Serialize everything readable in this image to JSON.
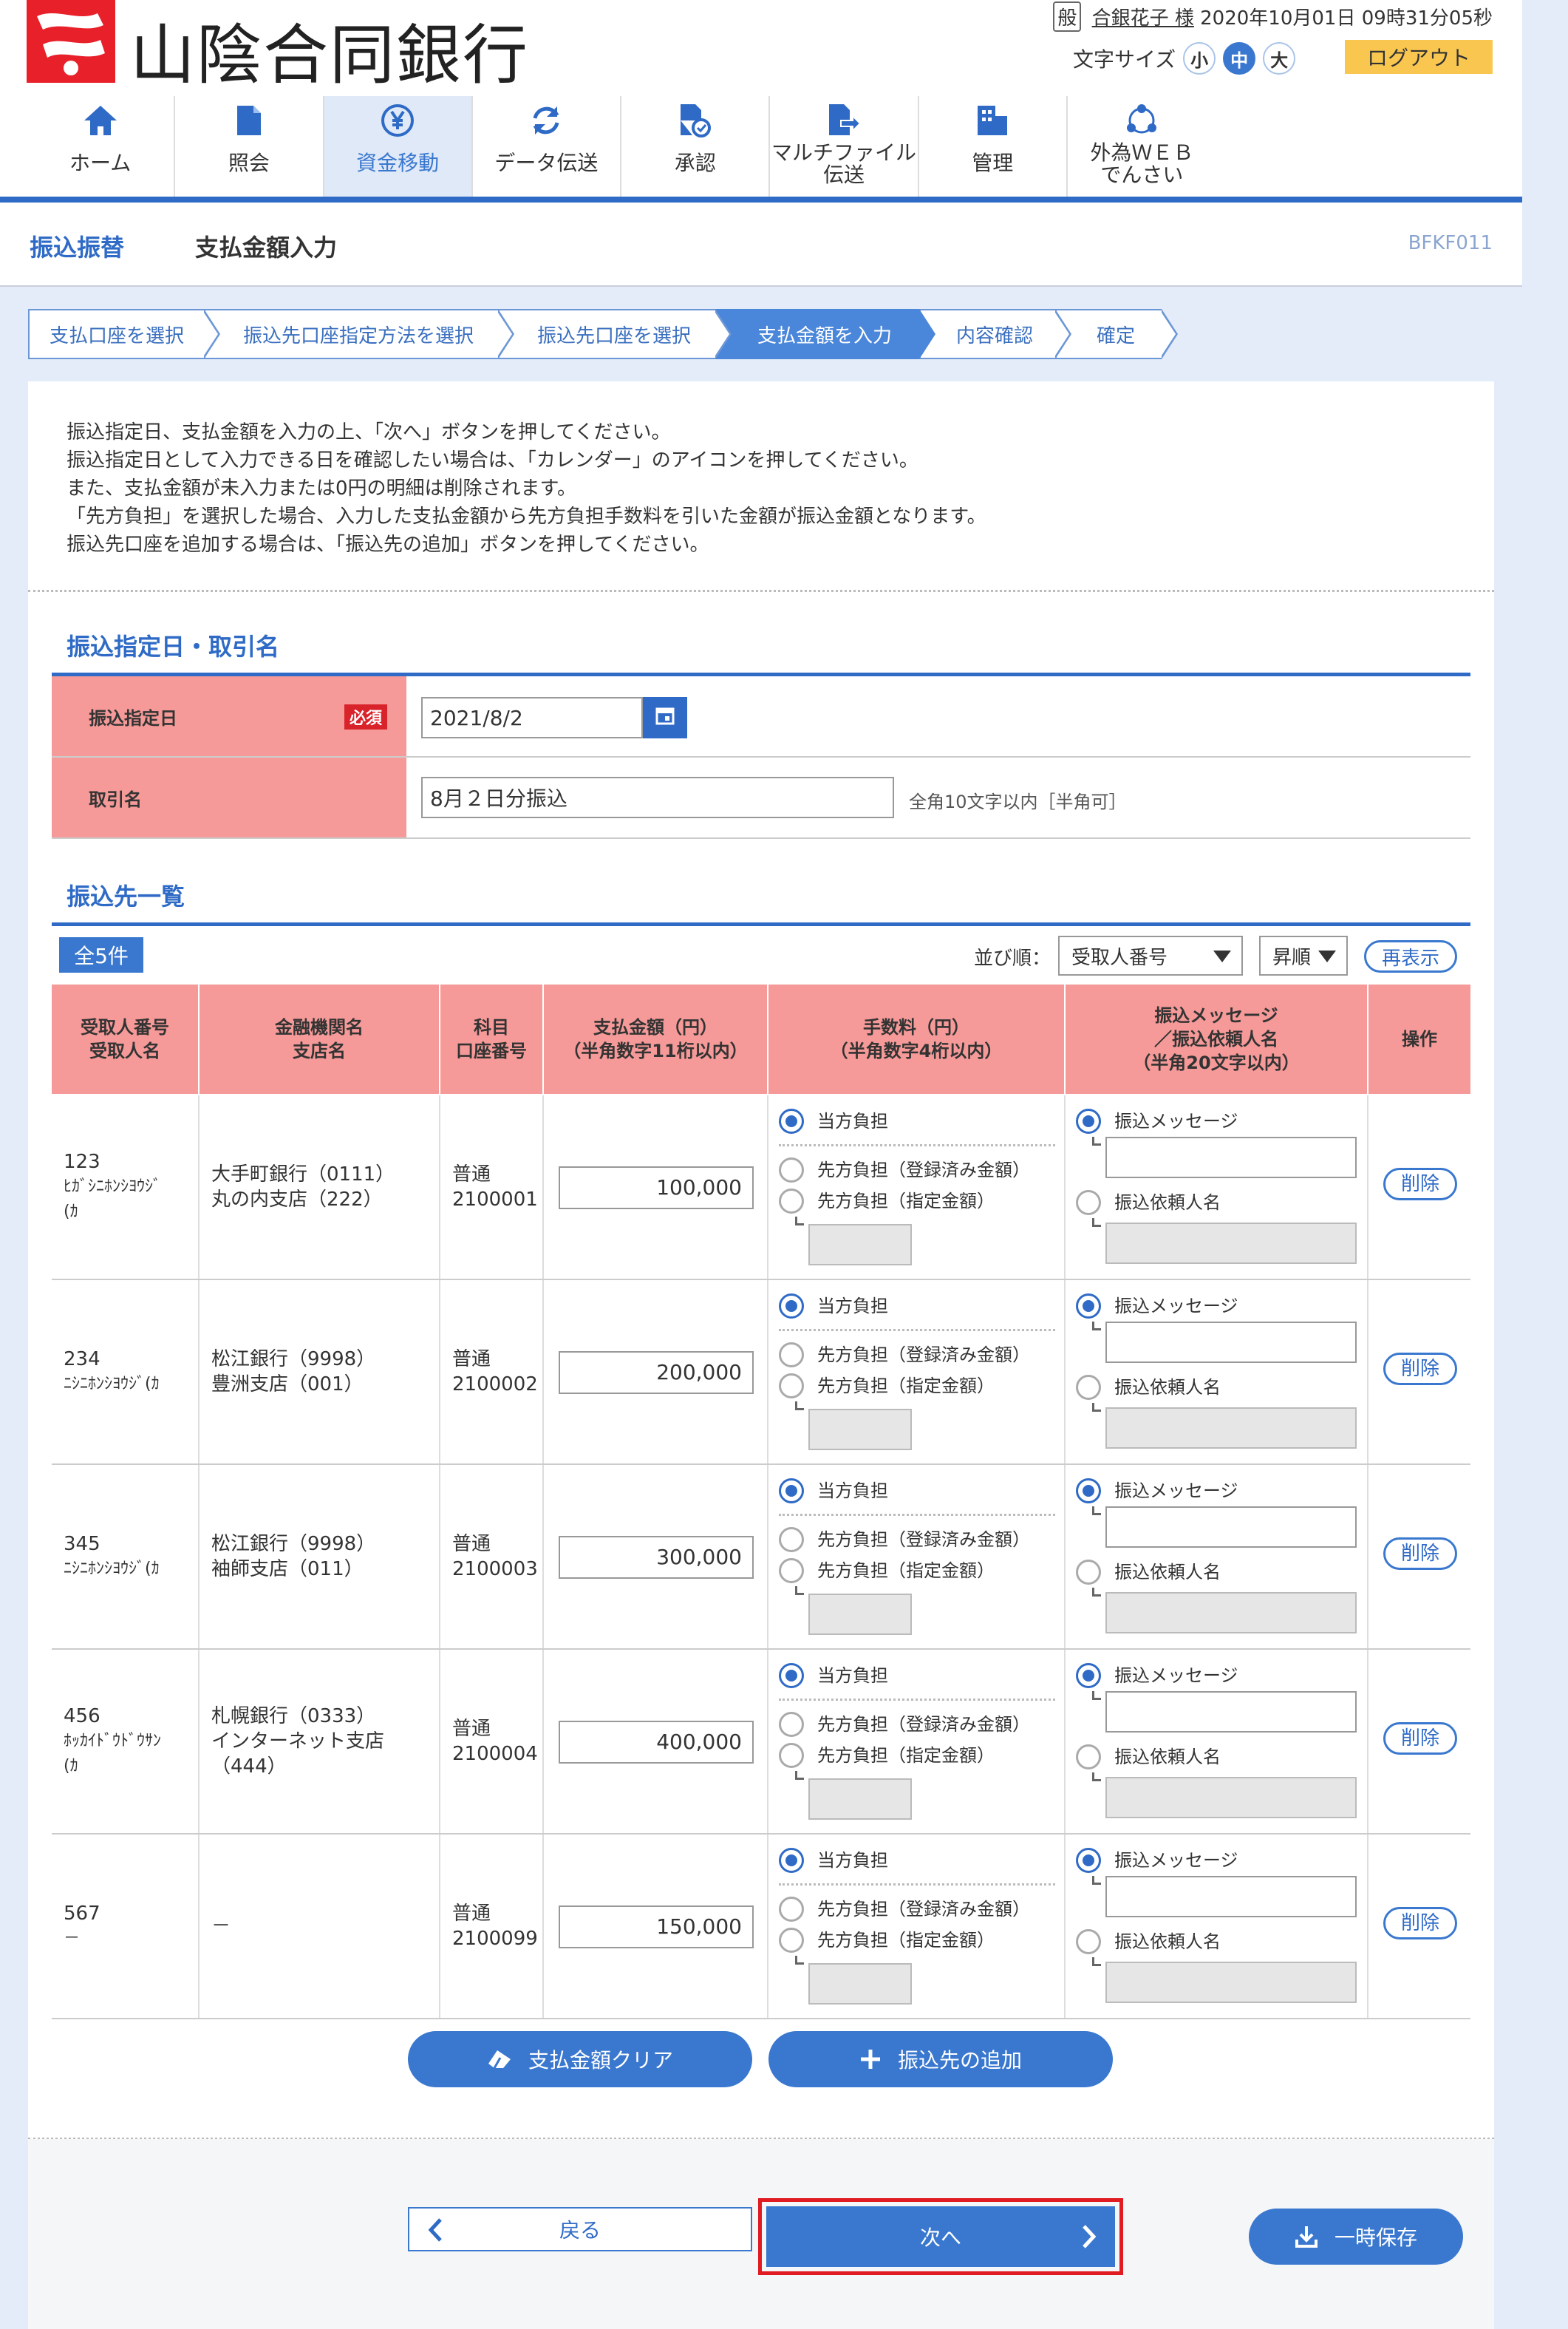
{
  "header": {
    "bank_name": "山陰合同銀行",
    "user_badge": "般",
    "user_name": "合銀花子 様",
    "datetime": "2020年10月01日 09時31分05秒",
    "font_size_label": "文字サイズ",
    "font_small": "小",
    "font_medium": "中",
    "font_large": "大",
    "logout": "ログアウト"
  },
  "nav": [
    {
      "label": "ホーム",
      "icon": "home-icon"
    },
    {
      "label": "照会",
      "icon": "document-icon"
    },
    {
      "label": "資金移動",
      "icon": "yen-transfer-icon"
    },
    {
      "label": "データ伝送",
      "icon": "refresh-icon"
    },
    {
      "label": "承認",
      "icon": "approve-icon"
    },
    {
      "label": "マルチファイル伝送",
      "l1": "マルチファイル",
      "l2": "伝送",
      "icon": "file-send-icon"
    },
    {
      "label": "管理",
      "icon": "building-icon"
    },
    {
      "label": "外為ＷＥＢでんさい",
      "l1": "外為ＷＥＢ",
      "l2": "でんさい",
      "icon": "network-icon"
    }
  ],
  "page": {
    "category": "振込振替",
    "title": "支払金額入力",
    "code": "BFKF011"
  },
  "steps": [
    "支払口座を選択",
    "振込先口座指定方法を選択",
    "振込先口座を選択",
    "支払金額を入力",
    "内容確認",
    "確定"
  ],
  "intro": [
    "振込指定日、支払金額を入力の上、「次へ」ボタンを押してください。",
    "振込指定日として入力できる日を確認したい場合は、「カレンダー」のアイコンを押してください。",
    "また、支払金額が未入力または0円の明細は削除されます。",
    "「先方負担」を選択した場合、入力した支払金額から先方負担手数料を引いた金額が振込金額となります。",
    "振込先口座を追加する場合は、「振込先の追加」ボタンを押してください。"
  ],
  "section1": {
    "title": "振込指定日・取引名",
    "date_label": "振込指定日",
    "required": "必須",
    "date_value": "2021/8/2",
    "name_label": "取引名",
    "name_value": "8月２日分振込",
    "name_hint": "全角10文字以内［半角可］"
  },
  "section2": {
    "title": "振込先一覧",
    "count": "全5件",
    "sort_label": "並び順：",
    "sort_value": "受取人番号",
    "order_value": "昇順",
    "refresh": "再表示"
  },
  "table": {
    "headers": {
      "h1a": "受取人番号",
      "h1b": "受取人名",
      "h2a": "金融機関名",
      "h2b": "支店名",
      "h3a": "科目",
      "h3b": "口座番号",
      "h4a": "支払金額（円）",
      "h4b": "（半角数字11桁以内）",
      "h5a": "手数料（円）",
      "h5b": "（半角数字4桁以内）",
      "h6a": "振込メッセージ",
      "h6b": "／振込依頼人名",
      "h6c": "（半角20文字以内）",
      "h7": "操作"
    },
    "fee_opt1": "当方負担",
    "fee_opt2": "先方負担（登録済み金額）",
    "fee_opt3": "先方負担（指定金額）",
    "msg_opt1": "振込メッセージ",
    "msg_opt2": "振込依頼人名",
    "delete": "削除",
    "rows": [
      {
        "num": "123",
        "kana1": "ﾋｶﾞｼﾆﾎﾝｼﾖｳｼﾞ",
        "kana2": "(ｶ",
        "bank": "大手町銀行（0111）",
        "branch": "丸の内支店（222）",
        "branch2": "",
        "type": "普通",
        "acct": "2100001",
        "amount": "100,000"
      },
      {
        "num": "234",
        "kana1": "ﾆｼﾆﾎﾝｼﾖｳｼﾞ(ｶ",
        "kana2": "",
        "bank": "松江銀行（9998）",
        "branch": "豊洲支店（001）",
        "branch2": "",
        "type": "普通",
        "acct": "2100002",
        "amount": "200,000"
      },
      {
        "num": "345",
        "kana1": "ﾆｼﾆﾎﾝｼﾖｳｼﾞ(ｶ",
        "kana2": "",
        "bank": "松江銀行（9998）",
        "branch": "袖師支店（011）",
        "branch2": "",
        "type": "普通",
        "acct": "2100003",
        "amount": "300,000"
      },
      {
        "num": "456",
        "kana1": "ﾎｯｶｲﾄﾞｳﾄﾞｳｻﾝ",
        "kana2": "(ｶ",
        "bank": "札幌銀行（0333）",
        "branch": "インターネット支店",
        "branch2": "（444）",
        "type": "普通",
        "acct": "2100004",
        "amount": "400,000"
      },
      {
        "num": "567",
        "kana1": "－",
        "kana2": "",
        "bank": "－",
        "branch": "",
        "branch2": "",
        "type": "普通",
        "acct": "2100099",
        "amount": "150,000"
      }
    ]
  },
  "actions": {
    "clear": "支払金額クリア",
    "add": "振込先の追加",
    "back": "戻る",
    "next": "次へ",
    "save": "一時保存"
  },
  "colors": {
    "primary": "#3a78cf",
    "header_pink": "#f59a98",
    "required_red": "#d9232a",
    "logout_yellow": "#f9c750"
  }
}
